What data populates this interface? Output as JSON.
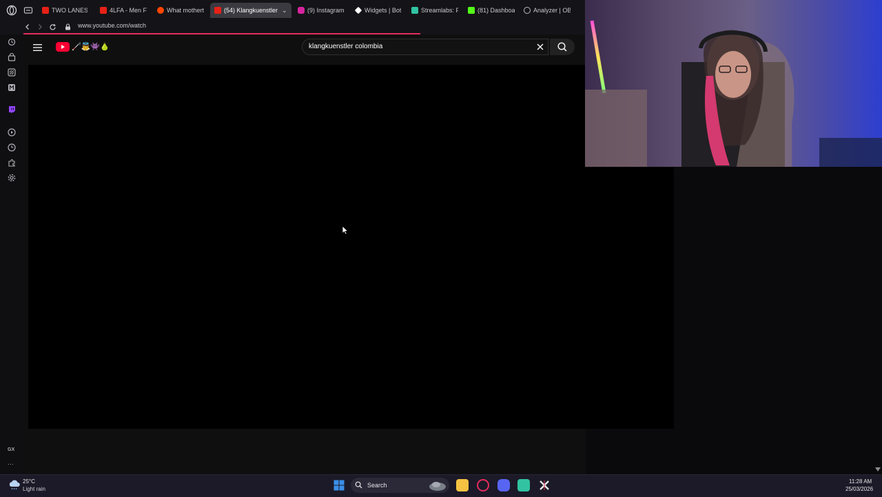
{
  "browser": {
    "tabs": [
      {
        "label": "TWO LANES -",
        "icon": "youtube-icon",
        "color": "#e62117"
      },
      {
        "label": "4LFA - Men F",
        "icon": "youtube-icon",
        "color": "#e62117"
      },
      {
        "label": "What mothert",
        "icon": "reddit-icon",
        "color": "#ff4500"
      },
      {
        "label": "(54) Klangkuenstler",
        "icon": "youtube-icon",
        "color": "#e62117",
        "active": true
      },
      {
        "label": "(9) Instagram",
        "icon": "instagram-icon",
        "color": "#d6249f"
      },
      {
        "label": "Widgets | Bot",
        "icon": "widgets-icon",
        "color": "#ffffff"
      },
      {
        "label": "Streamlabs: F",
        "icon": "streamlabs-icon",
        "color": "#31c3a2"
      },
      {
        "label": "(81) Dashboar",
        "icon": "dashboard-icon",
        "color": "#53fc18"
      },
      {
        "label": "Analyzer | OB",
        "icon": "analyzer-icon",
        "color": "#bbbbbb"
      }
    ],
    "url": "www.youtube.com/watch",
    "accent": "#e52d5d"
  },
  "sidebar": {
    "icons": [
      "history-icon",
      "shop-icon",
      "ai-icon",
      "messenger-icon",
      "twitch-icon",
      "player-icon",
      "clock-icon",
      "extensions-icon",
      "settings-icon"
    ],
    "gx_label": "GX",
    "more_label": "···"
  },
  "youtube": {
    "search_query": "klangkuenstler colombia",
    "channel_emoji": "🦯👼👾🍐",
    "brand_color": "#ff0033"
  },
  "taskbar": {
    "weather_temp": "25°C",
    "weather_condition": "Light rain",
    "search_label": "Search",
    "time": "11:28 AM",
    "date": "25/03/2026",
    "apps": [
      {
        "name": "file-explorer-icon",
        "color": "#f5c242"
      },
      {
        "name": "opera-gx-icon",
        "color": "#e52d5d"
      },
      {
        "name": "discord-icon",
        "color": "#5865f2"
      },
      {
        "name": "streamlabs-app-icon",
        "color": "#31c3a2"
      },
      {
        "name": "capcut-icon",
        "color": "#e8e8e8"
      }
    ]
  }
}
